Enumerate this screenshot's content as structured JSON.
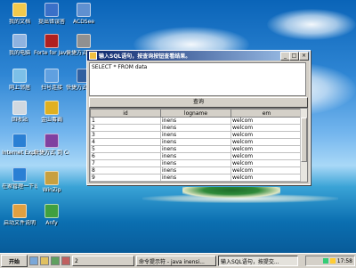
{
  "desktop": {
    "icons_left": [
      {
        "label": "我的文档",
        "icon": "folder-icon",
        "color": "#f2c94c"
      },
      {
        "label": "我的电脑",
        "icon": "computer-icon",
        "color": "#8fb3e0"
      },
      {
        "label": "网上邻居",
        "icon": "network-icon",
        "color": "#7cc0e8"
      },
      {
        "label": "回收站",
        "icon": "recycle-bin-icon",
        "color": "#d0d8e0"
      },
      {
        "label": "Internet Explorer",
        "icon": "ie-icon",
        "color": "#2a7fd4"
      },
      {
        "label": "在家管理一下设计",
        "icon": "ie-icon",
        "color": "#2a7fd4"
      },
      {
        "label": "启动文件说明",
        "icon": "document-icon",
        "color": "#e0a040"
      }
    ],
    "icons_col2": [
      {
        "label": "提出错误答",
        "icon": "help-icon",
        "color": "#3a70c8"
      },
      {
        "label": "Forte for Java CE",
        "icon": "java-icon",
        "color": "#b02020"
      },
      {
        "label": "扫号连接",
        "icon": "dialup-icon",
        "color": "#60a0e0"
      },
      {
        "label": "金山毒霸",
        "icon": "antivirus-icon",
        "color": "#e0b020"
      },
      {
        "label": "快捷方式 到 CesarFTP.exe",
        "icon": "ftp-icon",
        "color": "#8040a0"
      },
      {
        "label": "WinZip",
        "icon": "winzip-icon",
        "color": "#c8a040"
      },
      {
        "label": "Anfy",
        "icon": "anfy-icon",
        "color": "#40a040"
      }
    ],
    "icons_col3": [
      {
        "label": "ACDSee",
        "icon": "acdsee-icon",
        "color": "#6090d0"
      },
      {
        "label": "快捷方式 到 syschg",
        "icon": "shortcut-icon",
        "color": "#909090"
      },
      {
        "label": "快捷方式到 Photosh",
        "icon": "photoshop-icon",
        "color": "#3060a0"
      }
    ]
  },
  "window": {
    "title": "输入SQL语句，按查询按钮查看结果。",
    "sql_text": "SELECT * FROM data",
    "query_button": "查询",
    "columns": [
      "id",
      "logname",
      "em"
    ],
    "rows": [
      [
        "1",
        "inens",
        "welcom"
      ],
      [
        "2",
        "inens",
        "welcom"
      ],
      [
        "3",
        "inens",
        "welcom"
      ],
      [
        "4",
        "inens",
        "welcom"
      ],
      [
        "5",
        "inens",
        "welcom"
      ],
      [
        "6",
        "inens",
        "welcom"
      ],
      [
        "7",
        "inens",
        "welcom"
      ],
      [
        "8",
        "inens",
        "welcom"
      ],
      [
        "9",
        "inens",
        "welcom"
      ]
    ],
    "buttons": {
      "minimize": "_",
      "maximize": "□",
      "close": "×"
    }
  },
  "taskbar": {
    "start": "开始",
    "tasks": [
      {
        "label": "2",
        "active": false
      },
      {
        "label": "命令提示符 - java inensi...",
        "active": false
      },
      {
        "label": "输入SQL语句，按提交...",
        "active": true
      }
    ],
    "clock": "17:58"
  }
}
